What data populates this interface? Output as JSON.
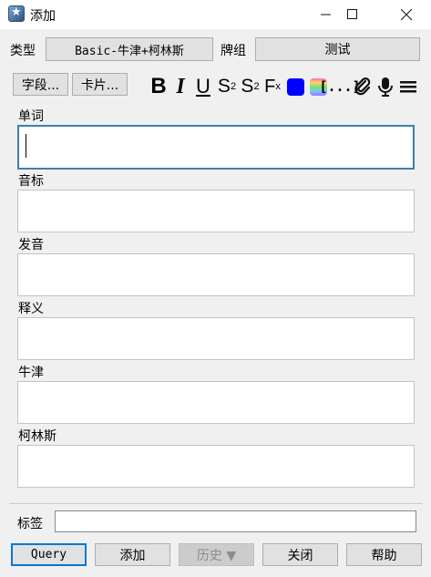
{
  "window": {
    "title": "添加"
  },
  "top": {
    "type_label": "类型",
    "type_value": "Basic-牛津+柯林斯",
    "deck_label": "牌组",
    "deck_value": "测试"
  },
  "toolbar": {
    "fields_button": "字段...",
    "cards_button": "卡片...",
    "icons": [
      "bold-icon",
      "italic-icon",
      "underline-icon",
      "superscript-icon",
      "subscript-icon",
      "clear-format-icon",
      "text-color-icon",
      "highlight-color-icon",
      "cloze-icon",
      "attach-icon",
      "record-audio-icon",
      "more-menu-icon"
    ],
    "colors": {
      "text_color": "#0000ff",
      "focus_border": "#3c7fb1"
    }
  },
  "fields": [
    {
      "label": "单词",
      "value": ""
    },
    {
      "label": "音标",
      "value": ""
    },
    {
      "label": "发音",
      "value": ""
    },
    {
      "label": "释义",
      "value": ""
    },
    {
      "label": "牛津",
      "value": ""
    },
    {
      "label": "柯林斯",
      "value": ""
    }
  ],
  "tags": {
    "label": "标签",
    "value": ""
  },
  "buttons": {
    "query": "Query",
    "add": "添加",
    "history": "历史 ▼",
    "close": "关闭",
    "help": "帮助"
  }
}
